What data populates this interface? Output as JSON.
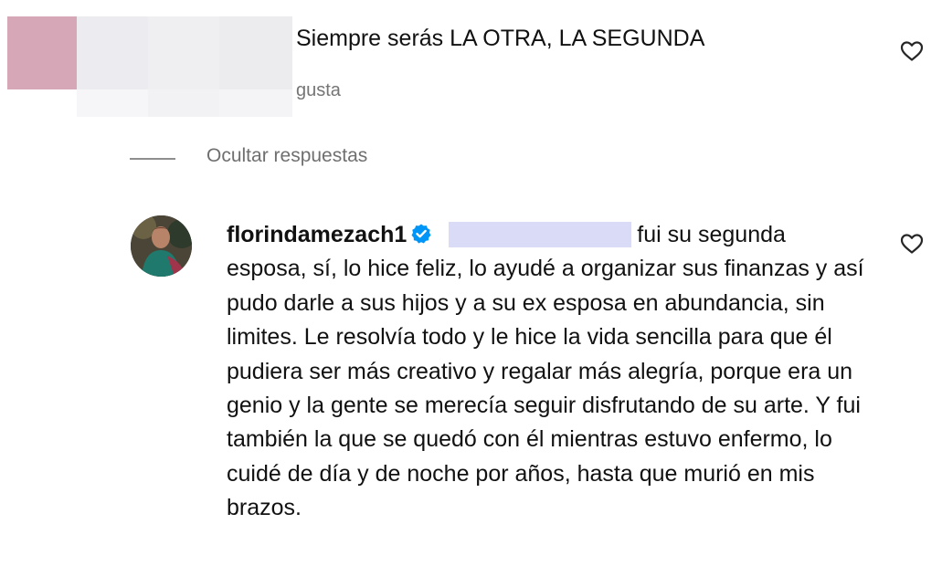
{
  "parent_comment": {
    "text": "Siempre serás LA OTRA, LA SEGUNDA",
    "likes_label": "gusta"
  },
  "replies_toggle": {
    "label": "Ocultar respuestas"
  },
  "reply": {
    "username": "florindamezach1",
    "verified": true,
    "text": "fui su segunda esposa, sí, lo hice feliz, lo ayudé a organizar sus finanzas y así pudo darle a sus hijos y a su ex esposa en abundancia, sin limites. Le resolvía todo y le hice la vida sencilla para que él pudiera ser más creativo y regalar más alegría, porque era un genio y la gente se merecía seguir disfrutando de su arte. Y fui también la que se quedó con él mientras estuvo enfermo, lo cuidé de día y de noche por años, hasta que murió en mis brazos."
  },
  "colors": {
    "verified_badge": "#0095f6",
    "redaction": "#d9dbf7",
    "muted_text": "#737373"
  },
  "icons": [
    "heart-icon",
    "verified-badge-icon",
    "avatar"
  ]
}
